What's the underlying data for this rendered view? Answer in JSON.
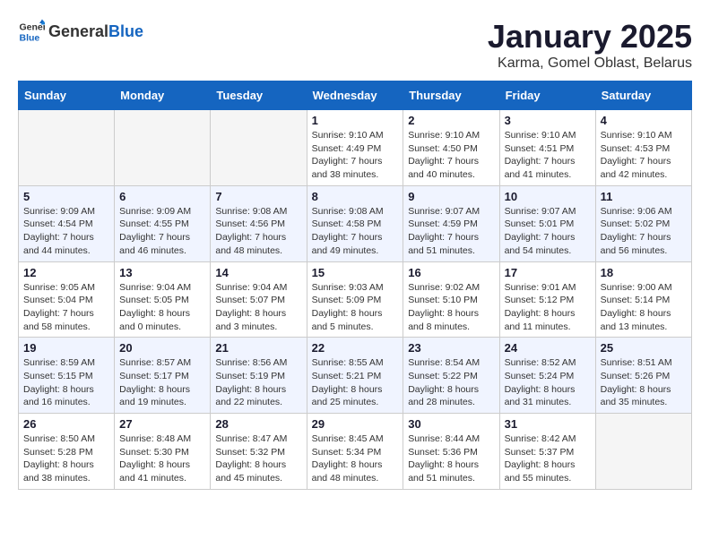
{
  "header": {
    "logo_general": "General",
    "logo_blue": "Blue",
    "month": "January 2025",
    "location": "Karma, Gomel Oblast, Belarus"
  },
  "weekdays": [
    "Sunday",
    "Monday",
    "Tuesday",
    "Wednesday",
    "Thursday",
    "Friday",
    "Saturday"
  ],
  "weeks": [
    {
      "shaded": false,
      "days": [
        {
          "num": "",
          "info": ""
        },
        {
          "num": "",
          "info": ""
        },
        {
          "num": "",
          "info": ""
        },
        {
          "num": "1",
          "info": "Sunrise: 9:10 AM\nSunset: 4:49 PM\nDaylight: 7 hours and 38 minutes."
        },
        {
          "num": "2",
          "info": "Sunrise: 9:10 AM\nSunset: 4:50 PM\nDaylight: 7 hours and 40 minutes."
        },
        {
          "num": "3",
          "info": "Sunrise: 9:10 AM\nSunset: 4:51 PM\nDaylight: 7 hours and 41 minutes."
        },
        {
          "num": "4",
          "info": "Sunrise: 9:10 AM\nSunset: 4:53 PM\nDaylight: 7 hours and 42 minutes."
        }
      ]
    },
    {
      "shaded": true,
      "days": [
        {
          "num": "5",
          "info": "Sunrise: 9:09 AM\nSunset: 4:54 PM\nDaylight: 7 hours and 44 minutes."
        },
        {
          "num": "6",
          "info": "Sunrise: 9:09 AM\nSunset: 4:55 PM\nDaylight: 7 hours and 46 minutes."
        },
        {
          "num": "7",
          "info": "Sunrise: 9:08 AM\nSunset: 4:56 PM\nDaylight: 7 hours and 48 minutes."
        },
        {
          "num": "8",
          "info": "Sunrise: 9:08 AM\nSunset: 4:58 PM\nDaylight: 7 hours and 49 minutes."
        },
        {
          "num": "9",
          "info": "Sunrise: 9:07 AM\nSunset: 4:59 PM\nDaylight: 7 hours and 51 minutes."
        },
        {
          "num": "10",
          "info": "Sunrise: 9:07 AM\nSunset: 5:01 PM\nDaylight: 7 hours and 54 minutes."
        },
        {
          "num": "11",
          "info": "Sunrise: 9:06 AM\nSunset: 5:02 PM\nDaylight: 7 hours and 56 minutes."
        }
      ]
    },
    {
      "shaded": false,
      "days": [
        {
          "num": "12",
          "info": "Sunrise: 9:05 AM\nSunset: 5:04 PM\nDaylight: 7 hours and 58 minutes."
        },
        {
          "num": "13",
          "info": "Sunrise: 9:04 AM\nSunset: 5:05 PM\nDaylight: 8 hours and 0 minutes."
        },
        {
          "num": "14",
          "info": "Sunrise: 9:04 AM\nSunset: 5:07 PM\nDaylight: 8 hours and 3 minutes."
        },
        {
          "num": "15",
          "info": "Sunrise: 9:03 AM\nSunset: 5:09 PM\nDaylight: 8 hours and 5 minutes."
        },
        {
          "num": "16",
          "info": "Sunrise: 9:02 AM\nSunset: 5:10 PM\nDaylight: 8 hours and 8 minutes."
        },
        {
          "num": "17",
          "info": "Sunrise: 9:01 AM\nSunset: 5:12 PM\nDaylight: 8 hours and 11 minutes."
        },
        {
          "num": "18",
          "info": "Sunrise: 9:00 AM\nSunset: 5:14 PM\nDaylight: 8 hours and 13 minutes."
        }
      ]
    },
    {
      "shaded": true,
      "days": [
        {
          "num": "19",
          "info": "Sunrise: 8:59 AM\nSunset: 5:15 PM\nDaylight: 8 hours and 16 minutes."
        },
        {
          "num": "20",
          "info": "Sunrise: 8:57 AM\nSunset: 5:17 PM\nDaylight: 8 hours and 19 minutes."
        },
        {
          "num": "21",
          "info": "Sunrise: 8:56 AM\nSunset: 5:19 PM\nDaylight: 8 hours and 22 minutes."
        },
        {
          "num": "22",
          "info": "Sunrise: 8:55 AM\nSunset: 5:21 PM\nDaylight: 8 hours and 25 minutes."
        },
        {
          "num": "23",
          "info": "Sunrise: 8:54 AM\nSunset: 5:22 PM\nDaylight: 8 hours and 28 minutes."
        },
        {
          "num": "24",
          "info": "Sunrise: 8:52 AM\nSunset: 5:24 PM\nDaylight: 8 hours and 31 minutes."
        },
        {
          "num": "25",
          "info": "Sunrise: 8:51 AM\nSunset: 5:26 PM\nDaylight: 8 hours and 35 minutes."
        }
      ]
    },
    {
      "shaded": false,
      "days": [
        {
          "num": "26",
          "info": "Sunrise: 8:50 AM\nSunset: 5:28 PM\nDaylight: 8 hours and 38 minutes."
        },
        {
          "num": "27",
          "info": "Sunrise: 8:48 AM\nSunset: 5:30 PM\nDaylight: 8 hours and 41 minutes."
        },
        {
          "num": "28",
          "info": "Sunrise: 8:47 AM\nSunset: 5:32 PM\nDaylight: 8 hours and 45 minutes."
        },
        {
          "num": "29",
          "info": "Sunrise: 8:45 AM\nSunset: 5:34 PM\nDaylight: 8 hours and 48 minutes."
        },
        {
          "num": "30",
          "info": "Sunrise: 8:44 AM\nSunset: 5:36 PM\nDaylight: 8 hours and 51 minutes."
        },
        {
          "num": "31",
          "info": "Sunrise: 8:42 AM\nSunset: 5:37 PM\nDaylight: 8 hours and 55 minutes."
        },
        {
          "num": "",
          "info": ""
        }
      ]
    }
  ]
}
